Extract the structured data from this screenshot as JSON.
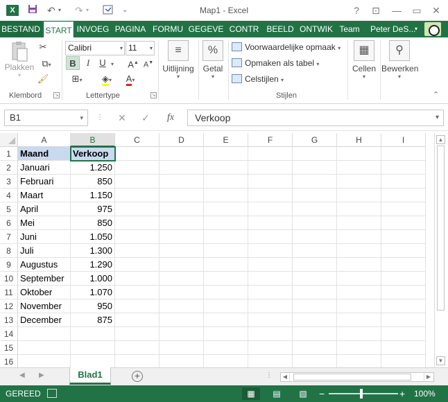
{
  "window": {
    "title": "Map1 - Excel",
    "app_icon": "X",
    "help": "?",
    "minimize": "—",
    "restore": "▭",
    "close": "✕"
  },
  "ribbon_tabs": [
    {
      "label": "BESTAND"
    },
    {
      "label": "START"
    },
    {
      "label": "INVOEG"
    },
    {
      "label": "PAGINA"
    },
    {
      "label": "FORMU"
    },
    {
      "label": "GEGEVE"
    },
    {
      "label": "CONTR"
    },
    {
      "label": "BEELD"
    },
    {
      "label": "ONTWIK"
    },
    {
      "label": "Team"
    }
  ],
  "user": {
    "name": "Peter DeS..."
  },
  "clipboard": {
    "paste_label": "Plakken",
    "group_label": "Klembord"
  },
  "font": {
    "name": "Calibri",
    "size": "11",
    "bold": "B",
    "italic": "I",
    "underline": "U",
    "grow": "A",
    "shrink": "A",
    "font_color": "A",
    "group_label": "Lettertype"
  },
  "alignment": {
    "label": "Uitlijning"
  },
  "number": {
    "label": "Getal"
  },
  "styles": {
    "conditional": "Voorwaardelijke opmaak",
    "as_table": "Opmaken als tabel",
    "cell_styles": "Celstijlen",
    "group_label": "Stijlen"
  },
  "cells_group": {
    "label": "Cellen"
  },
  "editing": {
    "label": "Bewerken"
  },
  "formula_bar": {
    "name_box": "B1",
    "content": "Verkoop"
  },
  "columns": [
    "A",
    "B",
    "C",
    "D",
    "E",
    "F",
    "G",
    "H",
    "I"
  ],
  "rows": [
    "1",
    "2",
    "3",
    "4",
    "5",
    "6",
    "7",
    "8",
    "9",
    "10",
    "11",
    "12",
    "13",
    "14",
    "15",
    "16"
  ],
  "sheet": {
    "data": [
      {
        "a": "Maand",
        "b": "Verkoop"
      },
      {
        "a": "Januari",
        "b": "1.250"
      },
      {
        "a": "Februari",
        "b": "850"
      },
      {
        "a": "Maart",
        "b": "1.150"
      },
      {
        "a": "April",
        "b": "975"
      },
      {
        "a": "Mei",
        "b": "850"
      },
      {
        "a": "Juni",
        "b": "1.050"
      },
      {
        "a": "Juli",
        "b": "1.300"
      },
      {
        "a": "Augustus",
        "b": "1.290"
      },
      {
        "a": "September",
        "b": "1.000"
      },
      {
        "a": "Oktober",
        "b": "1.070"
      },
      {
        "a": "November",
        "b": "950"
      },
      {
        "a": "December",
        "b": "875"
      }
    ]
  },
  "sheet_tabs": [
    {
      "label": "Blad1"
    }
  ],
  "status": {
    "ready": "GEREED",
    "zoom": "100%",
    "zoom_minus": "−",
    "zoom_plus": "+"
  },
  "colors": {
    "accent": "#217346",
    "header_fill": "#c9daf0"
  }
}
